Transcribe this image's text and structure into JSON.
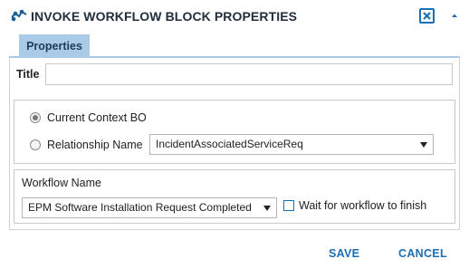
{
  "dialog": {
    "title": "INVOKE WORKFLOW BLOCK PROPERTIES",
    "icon": "workflow-block-icon",
    "close_icon": "close-icon",
    "collapse_icon": "caret-up-icon",
    "accent_color": "#1b6fb5",
    "tab_color": "#a9cbe8"
  },
  "tabs": [
    {
      "label": "Properties",
      "active": true
    }
  ],
  "form": {
    "title_label": "Title",
    "title_value": "",
    "context": {
      "current_context_label": "Current Context BO",
      "current_context_selected": true,
      "relationship_label": "Relationship Name",
      "relationship_selected": false,
      "relationship_value": "IncidentAssociatedServiceReq"
    },
    "workflow": {
      "section_label": "Workflow Name",
      "workflow_value": "EPM Software Installation Request Completed",
      "wait_label": "Wait for workflow to finish",
      "wait_checked": false
    }
  },
  "footer": {
    "save_label": "SAVE",
    "cancel_label": "CANCEL"
  }
}
